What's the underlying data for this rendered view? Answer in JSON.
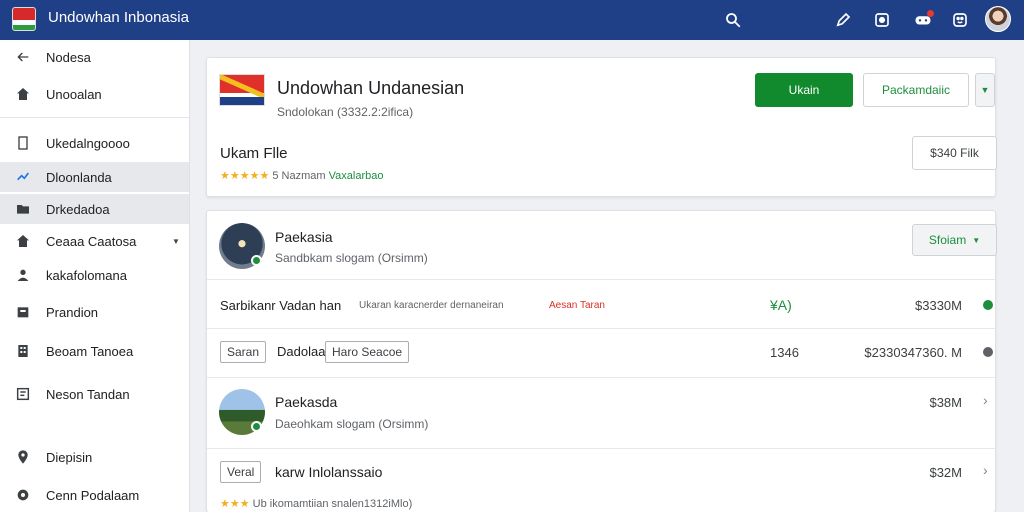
{
  "app": {
    "title": "Undowhan Inbonasia",
    "colors": {
      "header": "#1f3f86",
      "accent_green": "#118a2e",
      "sidebar_active": "#e6e8eb"
    },
    "top_icons": [
      "search-icon",
      "pen-icon",
      "record-icon",
      "gamepad-icon",
      "apps-icon",
      "avatar"
    ]
  },
  "sidebar": {
    "items": [
      {
        "label": "Nodesa",
        "icon": "arrow-left-icon"
      },
      {
        "label": "Unooalan",
        "icon": "home-icon"
      },
      {
        "label": "Ukedalngoooo",
        "icon": "document-icon"
      },
      {
        "label": "Dloonlanda",
        "icon": "sync-icon"
      },
      {
        "label": "Drkedadoa",
        "icon": "folder-icon"
      },
      {
        "label": "Ceaaa Caatosa",
        "icon": "home-icon"
      },
      {
        "label": "kakafolomana",
        "icon": "user-icon"
      },
      {
        "label": "Prandion",
        "icon": "box-icon"
      },
      {
        "label": "Beoam Tanoea",
        "icon": "building-icon"
      },
      {
        "label": "Neson Tandan",
        "icon": "square-icon"
      },
      {
        "label": "Diepisin",
        "icon": "location-icon"
      },
      {
        "label": "Cenn Podalaam",
        "icon": "settings-icon"
      }
    ]
  },
  "header_card": {
    "title": "Undowhan Undanesian",
    "subtitle": "Sndolokan (3332.2:2ifica)",
    "primary_button": "Ukain",
    "secondary_button": "Packamdaiic",
    "file_title": "Ukam Flle",
    "stars": "★★★★★",
    "rating_text": "5 Nazmam",
    "rating_highlight": "Vaxalarbao",
    "file_button": "$340 Filk"
  },
  "list": {
    "filter_button": "Sfoiam",
    "rows": [
      {
        "name": "Paekasia",
        "sub": "Sandbkam slogam (Orsimm)",
        "avatar": "night-city"
      },
      {
        "title": "Sarbikanr Vadan han",
        "detail": "Ukaran karacnerder dernaneiran",
        "tag": "Aesan Taran",
        "mid": "¥A)",
        "price": "$3330M"
      },
      {
        "chip1": "Saran",
        "text": "Dadolaa",
        "chip2": "Haro Seacoe",
        "mid": "1346",
        "price": "$2330347360. M"
      },
      {
        "name": "Paekasda",
        "sub": "Daeohkam slogam (Orsimm)",
        "avatar": "landscape",
        "price": "$38M"
      },
      {
        "chip1": "Veral",
        "text": "karw Inlolanssaio",
        "price": "$32M",
        "stars": "★★★",
        "rating": "Ub ikomamtiian snalen1312iMlo)"
      }
    ]
  }
}
